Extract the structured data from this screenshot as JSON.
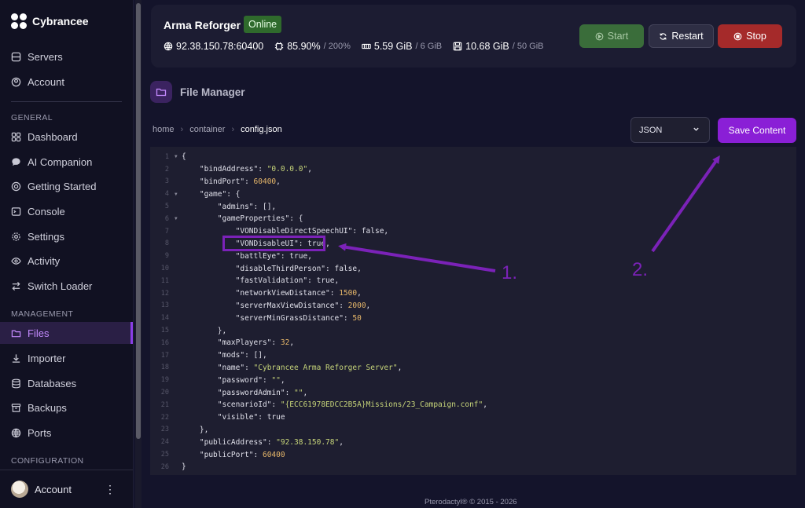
{
  "brand": {
    "name": "Cybrancee"
  },
  "sidebar": {
    "top_items": [
      {
        "label": "Servers",
        "icon": "servers-icon"
      },
      {
        "label": "Account",
        "icon": "account-icon"
      }
    ],
    "section_general": "GENERAL",
    "general_items": [
      {
        "label": "Dashboard",
        "icon": "dashboard-icon"
      },
      {
        "label": "AI Companion",
        "icon": "chat-icon"
      },
      {
        "label": "Getting Started",
        "icon": "lifebuoy-icon"
      },
      {
        "label": "Console",
        "icon": "console-icon"
      },
      {
        "label": "Settings",
        "icon": "gear-icon"
      },
      {
        "label": "Activity",
        "icon": "eye-icon"
      },
      {
        "label": "Switch Loader",
        "icon": "switch-icon"
      }
    ],
    "section_management": "MANAGEMENT",
    "management_items": [
      {
        "label": "Files",
        "icon": "folder-icon",
        "active": true
      },
      {
        "label": "Importer",
        "icon": "download-icon"
      },
      {
        "label": "Databases",
        "icon": "database-icon"
      },
      {
        "label": "Backups",
        "icon": "archive-icon"
      },
      {
        "label": "Ports",
        "icon": "globe-icon"
      }
    ],
    "section_configuration": "CONFIGURATION",
    "account_label": "Account"
  },
  "server": {
    "name": "Arma Reforger",
    "status": "Online",
    "address": "92.38.150.78:60400",
    "cpu": "85.90%",
    "cpu_limit": "/ 200%",
    "memory": "5.59 GiB",
    "memory_limit": "/ 6 GiB",
    "disk": "10.68 GiB",
    "disk_limit": "/ 50 GiB"
  },
  "actions": {
    "start": "Start",
    "restart": "Restart",
    "stop": "Stop"
  },
  "file_manager": {
    "title": "File Manager",
    "breadcrumb": [
      "home",
      "container",
      "config.json"
    ],
    "mode": "JSON",
    "save_label": "Save Content"
  },
  "editor": {
    "lines": [
      "{",
      "    \"bindAddress\": \"0.0.0.0\",",
      "    \"bindPort\": 60400,",
      "    \"game\": {",
      "        \"admins\": [],",
      "        \"gameProperties\": {",
      "            \"VONDisableDirectSpeechUI\": false,",
      "            \"VONDisableUI\": true,",
      "            \"battlEye\": true,",
      "            \"disableThirdPerson\": false,",
      "            \"fastValidation\": true,",
      "            \"networkViewDistance\": 1500,",
      "            \"serverMaxViewDistance\": 2000,",
      "            \"serverMinGrassDistance\": 50",
      "        },",
      "        \"maxPlayers\": 32,",
      "        \"mods\": [],",
      "        \"name\": \"Cybrancee Arma Reforger Server\",",
      "        \"password\": \"\",",
      "        \"passwordAdmin\": \"\",",
      "        \"scenarioId\": \"{ECC61978EDCC2B5A}Missions/23_Campaign.conf\",",
      "        \"visible\": true",
      "    },",
      "    \"publicAddress\": \"92.38.150.78\",",
      "    \"publicPort\": 60400",
      "}"
    ],
    "folded_lines": [
      1,
      4,
      6
    ]
  },
  "annotations": {
    "one": "1.",
    "two": "2."
  },
  "footer": "Pterodactyl® © 2015 - 2026",
  "colors": {
    "accent": "#8a1fd6",
    "online": "#2f6a2c",
    "stop": "#a52a2a",
    "annotation": "#7b22b8"
  }
}
